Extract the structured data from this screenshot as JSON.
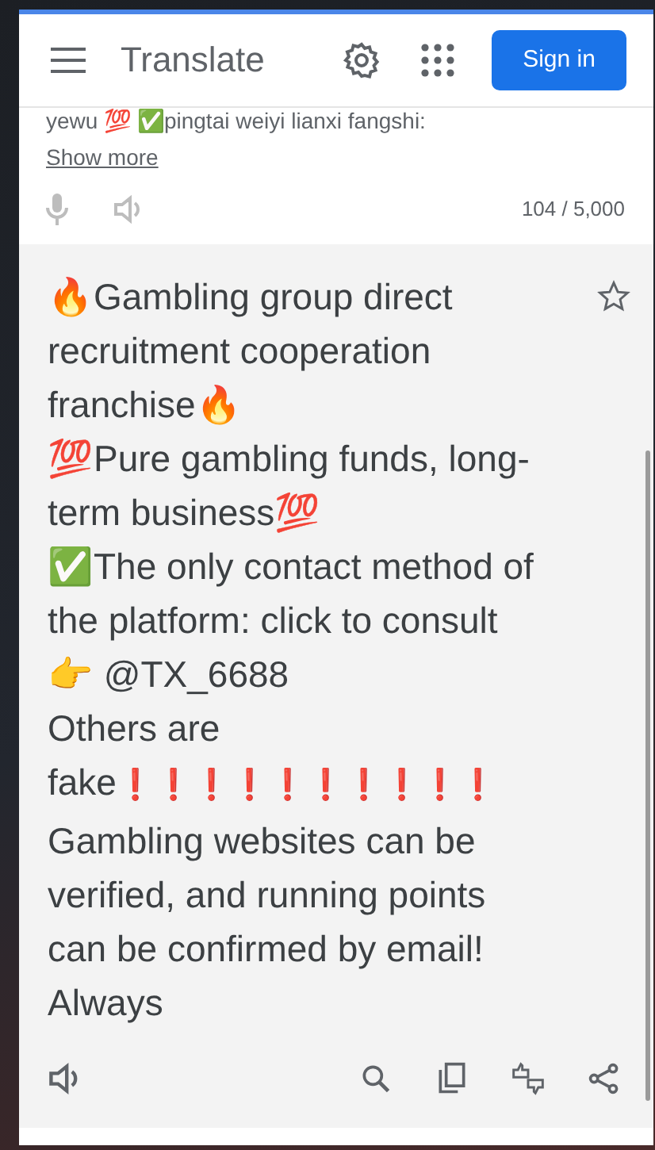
{
  "header": {
    "title": "Translate",
    "sign_in": "Sign in"
  },
  "source": {
    "text": "yewu 💯 ✅pingtai weiyi lianxi fangshi:",
    "show_more": "Show more",
    "char_count": "104 / 5,000"
  },
  "translation": {
    "lines": [
      {
        "text": "🔥Gambling group direct recruitment cooperation franchise🔥"
      },
      {
        "text": "💯Pure gambling funds, long-term business💯"
      },
      {
        "text": "✅The only contact method of the platform: click to consult👉 @TX_6688"
      },
      {
        "text": "Others are fake",
        "marks": "❗❗❗❗❗❗❗❗❗❗"
      },
      {
        "text": "Gambling websites can be verified, and running points can be confirmed by email! Always"
      }
    ]
  }
}
